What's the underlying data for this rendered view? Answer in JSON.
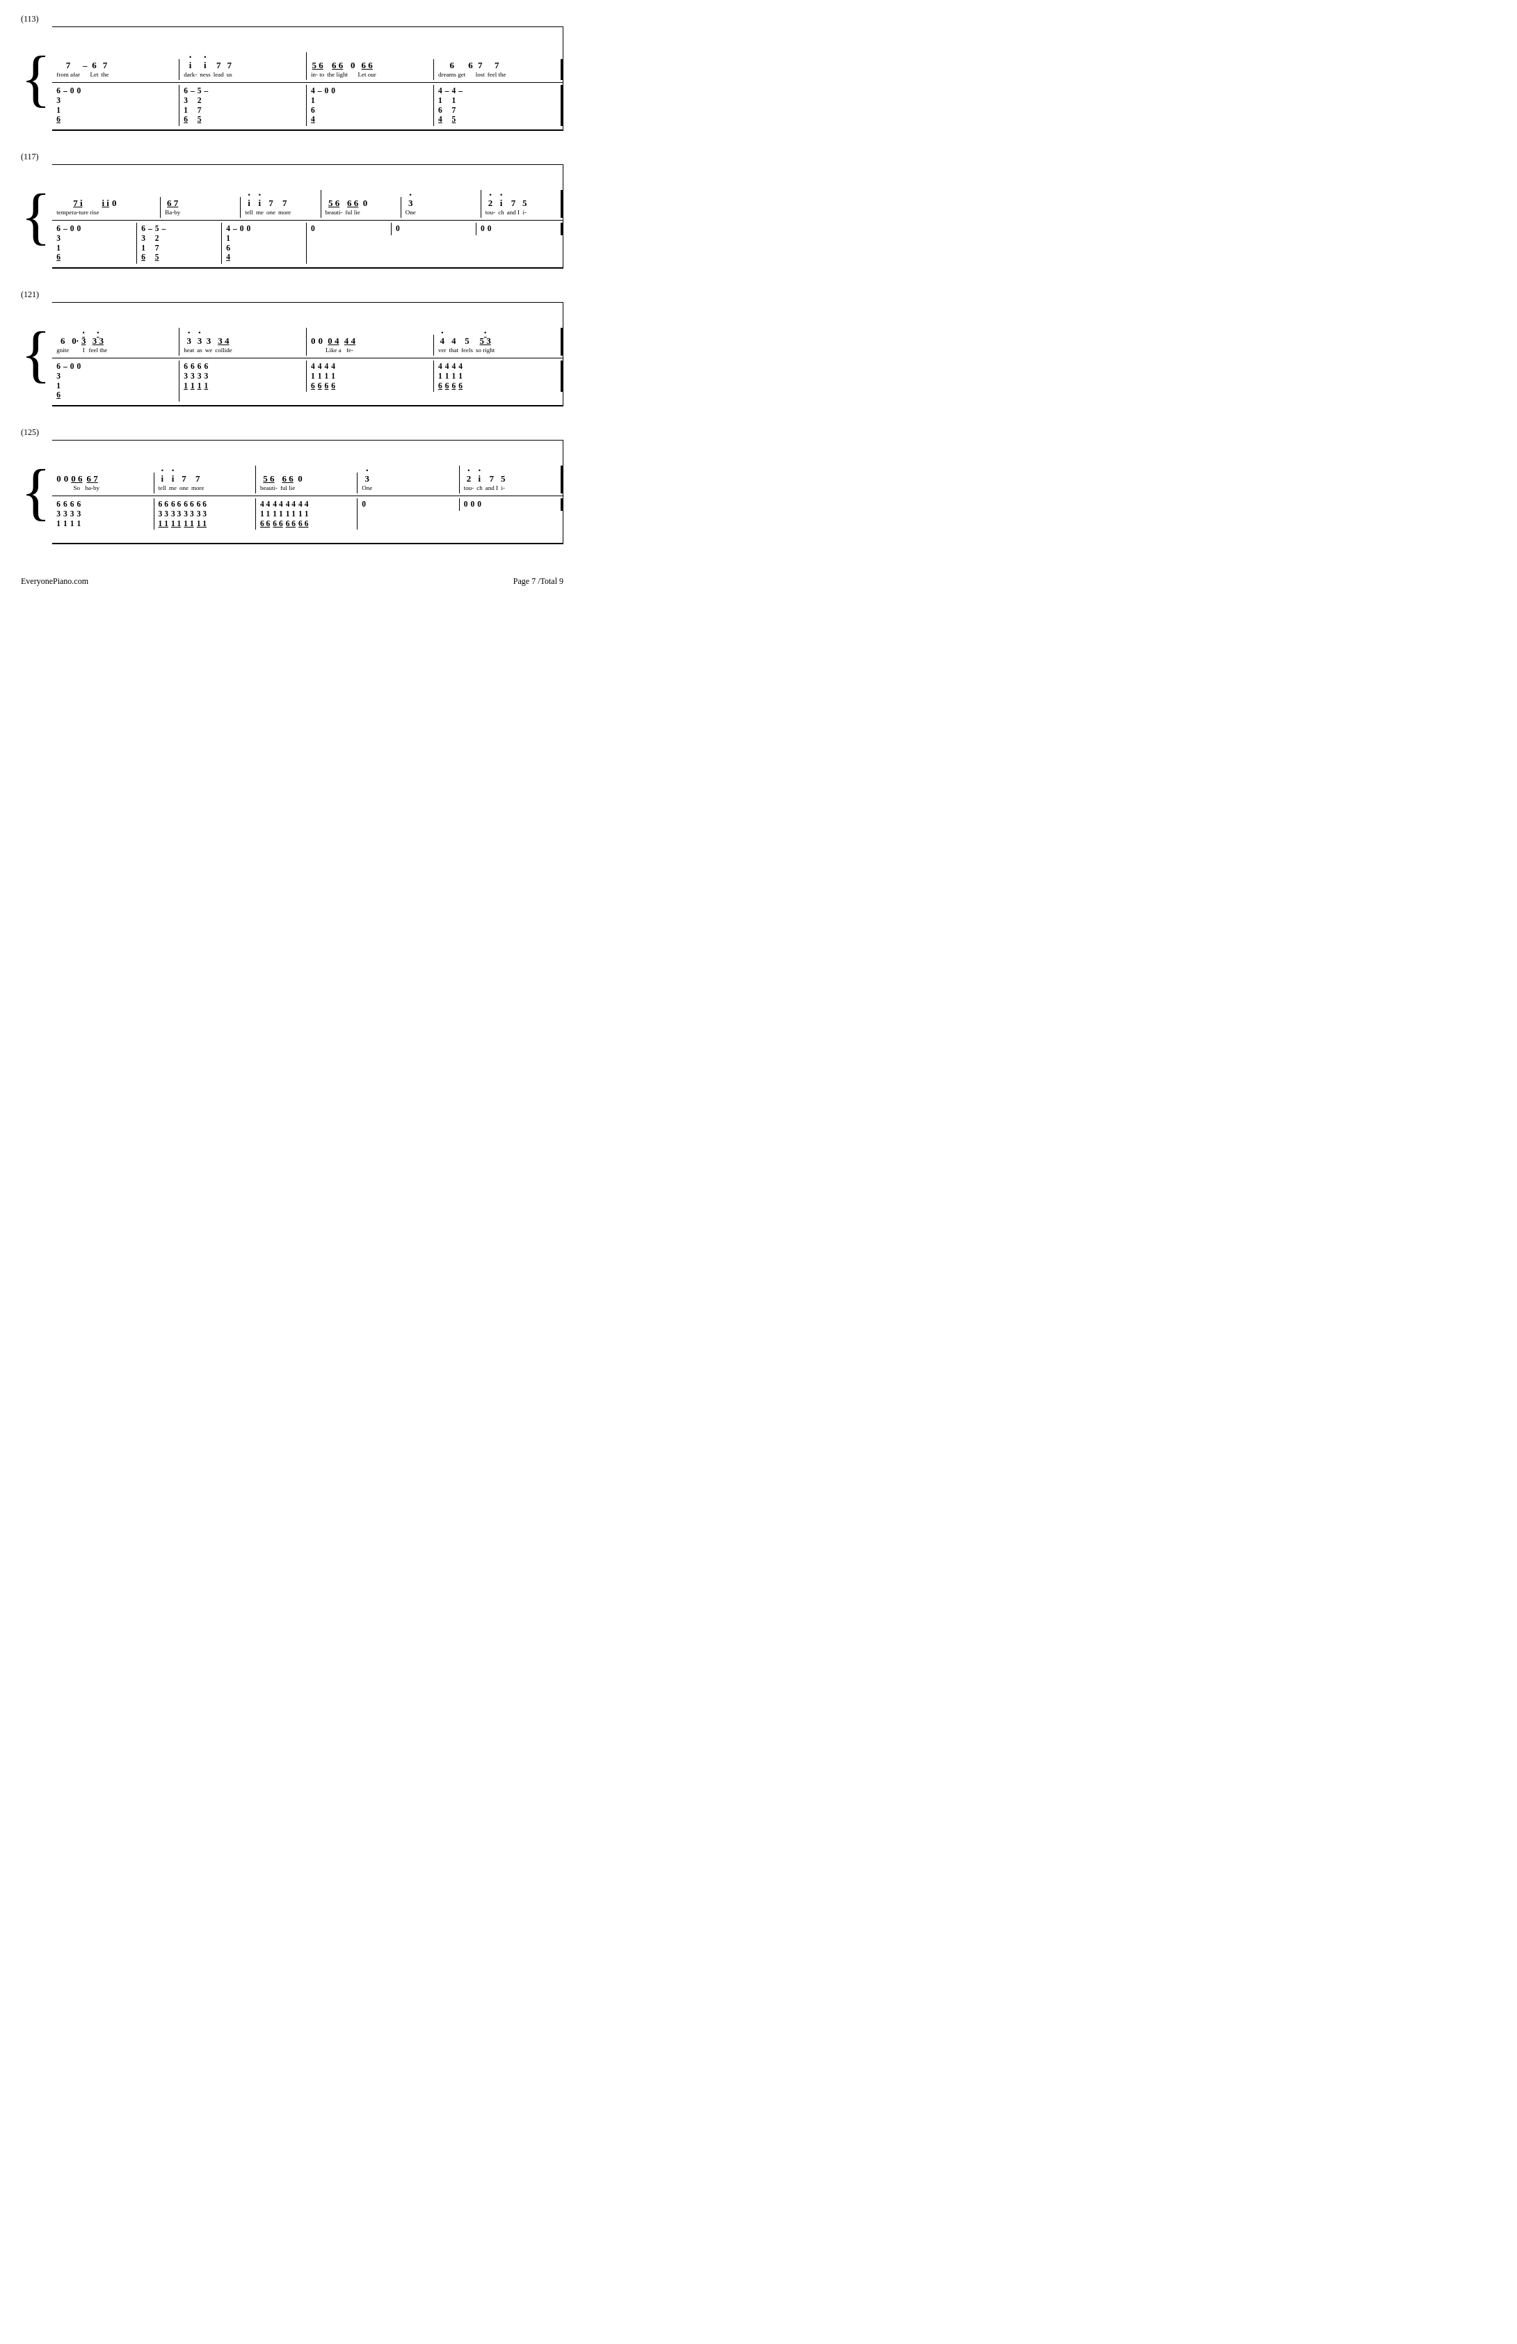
{
  "page": {
    "footer_left": "EveryonePiano.com",
    "footer_right": "Page 7 /Total 9"
  },
  "sections": [
    {
      "id": "sec113",
      "label": "(113)",
      "upper_measures": [
        {
          "notes": [
            {
              "main": "7",
              "lyric": "from afar"
            },
            {
              "main": "–",
              "lyric": ""
            },
            {
              "main": "6",
              "lyric": "Let"
            },
            {
              "main": "7",
              "lyric": "the"
            }
          ]
        },
        {
          "notes": [
            {
              "main": "i",
              "dot": true,
              "lyric": "dark-"
            },
            {
              "main": "i",
              "dot": true,
              "lyric": "ness"
            },
            {
              "main": "7",
              "lyric": "lead"
            },
            {
              "main": "7",
              "lyric": "us"
            }
          ]
        },
        {
          "notes": [
            {
              "main": "56",
              "underline": true,
              "lyric": "in- to"
            },
            {
              "main": "66",
              "underline": true,
              "lyric": "thelight"
            },
            {
              "main": "0",
              "lyric": ""
            },
            {
              "main": "66",
              "underline": true,
              "lyric": "Let our"
            }
          ]
        },
        {
          "notes": [
            {
              "main": "6",
              "lyric": "dreamsget"
            },
            {
              "main": "6",
              "lyric": ""
            },
            {
              "main": "7",
              "lyric": "lost"
            },
            {
              "main": "7",
              "lyric": "feel the"
            }
          ]
        }
      ],
      "lower_measures": [
        {
          "notes": [
            {
              "stack": [
                "6",
                "3",
                "1",
                "6"
              ],
              "dot_bottom": true
            },
            {
              "main": "–"
            },
            {
              "main": "0"
            },
            {
              "main": "0"
            }
          ]
        },
        {
          "notes": [
            {
              "stack": [
                "6",
                "3",
                "1",
                "6"
              ],
              "dot_bottom": true
            },
            {
              "main": "–"
            },
            {
              "stack": [
                "5",
                "2",
                "7",
                "5"
              ],
              "dot_bottom": true
            },
            {
              "main": "–"
            }
          ]
        },
        {
          "notes": [
            {
              "stack": [
                "4",
                "1",
                "6",
                "4"
              ],
              "dot_bottom": true
            },
            {
              "main": "–"
            },
            {
              "main": "0"
            },
            {
              "main": "0"
            }
          ]
        },
        {
          "notes": [
            {
              "stack": [
                "4",
                "1",
                "6",
                "4"
              ],
              "dot_bottom": true
            },
            {
              "main": "–"
            },
            {
              "stack": [
                "4",
                "1",
                "7",
                "5"
              ],
              "dot_bottom": true
            },
            {
              "main": "–"
            }
          ]
        }
      ]
    },
    {
      "id": "sec117",
      "label": "(117)",
      "upper_measures": [
        {
          "notes": [
            {
              "main": "7i",
              "underline": true,
              "extra": "ii",
              "lyric": "tempera-turerise"
            }
          ]
        },
        {
          "notes": [
            {
              "main": "67",
              "underline": true,
              "lyric": "Ba-by"
            }
          ]
        },
        {
          "notes": [
            {
              "main": "i",
              "dot": true,
              "lyric": "tell"
            },
            {
              "main": "i",
              "dot": true,
              "lyric": "me"
            },
            {
              "main": "7",
              "lyric": "one"
            },
            {
              "main": "7",
              "lyric": "more"
            }
          ]
        },
        {
          "notes": [
            {
              "main": "56",
              "underline": true,
              "lyric": "beauti-"
            },
            {
              "main": "66",
              "underline": true,
              "lyric": "ful lie"
            },
            {
              "main": "0",
              "lyric": ""
            }
          ]
        },
        {
          "notes": [
            {
              "main": "3",
              "dot": true,
              "lyric": "One"
            }
          ]
        },
        {
          "notes": [
            {
              "main": "2",
              "dot": true,
              "lyric": "tou-"
            },
            {
              "main": "i",
              "dot": true,
              "lyric": "ch"
            },
            {
              "main": "7",
              "lyric": "and I"
            },
            {
              "main": "5",
              "lyric": "i-"
            }
          ]
        }
      ]
    },
    {
      "id": "sec121",
      "label": "(121)",
      "upper_measures": [
        {
          "notes": [
            {
              "main": "6",
              "lyric": "gnite"
            },
            {
              "main": "0·",
              "lyric": ""
            },
            {
              "main": "3",
              "dot": true,
              "underline": true,
              "lyric": "I"
            },
            {
              "main": "33",
              "underline": true,
              "lyric": "feel the"
            }
          ]
        },
        {
          "notes": [
            {
              "main": "3",
              "dot": true,
              "lyric": "heat"
            },
            {
              "main": "3",
              "dot": true,
              "lyric": "as"
            },
            {
              "main": "3",
              "lyric": "we"
            },
            {
              "main": "34",
              "underline": true,
              "lyric": "collide"
            }
          ]
        },
        {
          "notes": [
            {
              "main": "0",
              "lyric": ""
            },
            {
              "main": "0",
              "lyric": ""
            },
            {
              "main": "04",
              "underline": true,
              "lyric": "Like a"
            },
            {
              "main": "44",
              "underline": true,
              "lyric": "fe-"
            }
          ]
        },
        {
          "notes": [
            {
              "main": "4",
              "dot": true,
              "lyric": "ver"
            },
            {
              "main": "4",
              "lyric": "that"
            },
            {
              "main": "5",
              "lyric": "feels"
            },
            {
              "main": "53",
              "underline": true,
              "lyric": "so right"
            }
          ]
        }
      ]
    },
    {
      "id": "sec125",
      "label": "(125)",
      "upper_measures": [
        {
          "notes": [
            {
              "main": "0",
              "lyric": ""
            },
            {
              "main": "0",
              "lyric": ""
            },
            {
              "main": "06",
              "underline": true,
              "lyric": "So"
            },
            {
              "main": "67",
              "underline": true,
              "lyric": "ba-by"
            }
          ]
        },
        {
          "notes": [
            {
              "main": "i",
              "dot": true,
              "lyric": "tell"
            },
            {
              "main": "i",
              "dot": true,
              "lyric": "me"
            },
            {
              "main": "7",
              "lyric": "one"
            },
            {
              "main": "7",
              "lyric": "more"
            }
          ]
        },
        {
          "notes": [
            {
              "main": "56",
              "underline": true,
              "lyric": "beauti-"
            },
            {
              "main": "66",
              "underline": true,
              "lyric": "ful lie"
            },
            {
              "main": "0",
              "lyric": ""
            }
          ]
        },
        {
          "notes": [
            {
              "main": "3",
              "dot": true,
              "lyric": "One"
            }
          ]
        },
        {
          "notes": [
            {
              "main": "2",
              "dot": true,
              "lyric": "tou-"
            },
            {
              "main": "i",
              "dot": true,
              "lyric": "ch"
            },
            {
              "main": "7",
              "lyric": "and I"
            },
            {
              "main": "5",
              "lyric": "i-"
            }
          ]
        }
      ]
    }
  ]
}
